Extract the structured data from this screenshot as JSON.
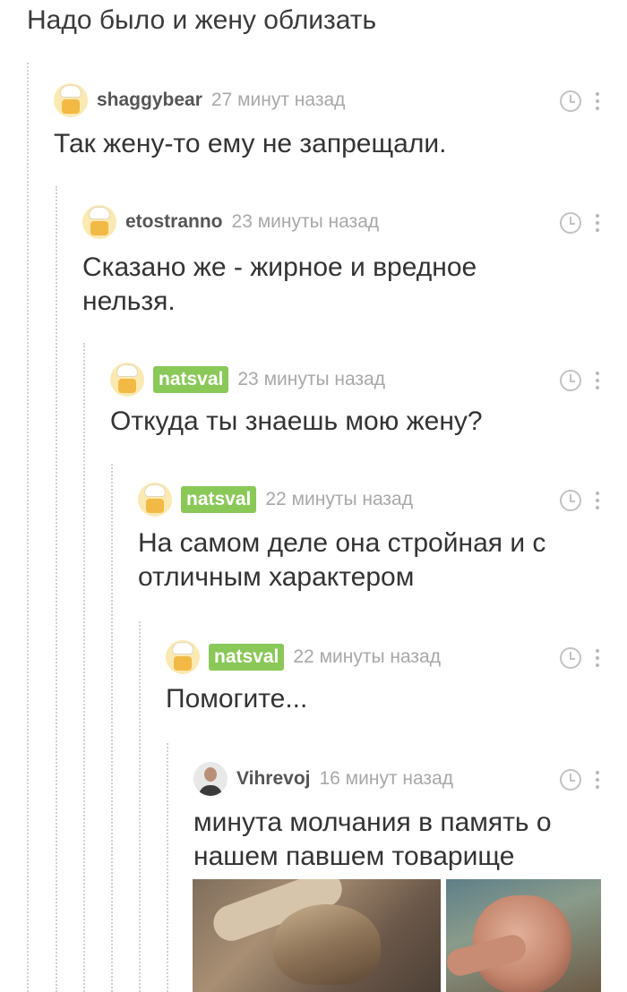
{
  "top_text": "Надо было и жену облизать",
  "comments": [
    {
      "username": "shaggybear",
      "time": "27 минут назад",
      "text_lines": [
        "Так жену-то ему не запрещали."
      ]
    },
    {
      "username": "etostranno",
      "time": "23 минуты назад",
      "text_lines": [
        "Сказано же - жирное и вредное",
        "нельзя."
      ]
    },
    {
      "username": "natsval",
      "time": "23 минуты назад",
      "text_lines": [
        "Откуда ты знаешь мою жену?"
      ]
    },
    {
      "username": "natsval",
      "time": "22 минуты назад",
      "text_lines": [
        "На самом деле она стройная и с",
        "отличным характером"
      ]
    },
    {
      "username": "natsval",
      "time": "22 минуты назад",
      "text_lines": [
        "Помогите..."
      ]
    },
    {
      "username": "Vihrevoj",
      "time": "16 минут назад",
      "text_lines": [
        "минута молчания в память о",
        "нашем павшем товарище"
      ]
    }
  ],
  "icons": {
    "clock": "clock-icon",
    "more": "more-vertical-icon",
    "avatar_default": "chef-avatar-icon"
  },
  "colors": {
    "badge": "#8ac858",
    "time": "#a8a8a8",
    "username": "#555555",
    "text": "#333333"
  }
}
